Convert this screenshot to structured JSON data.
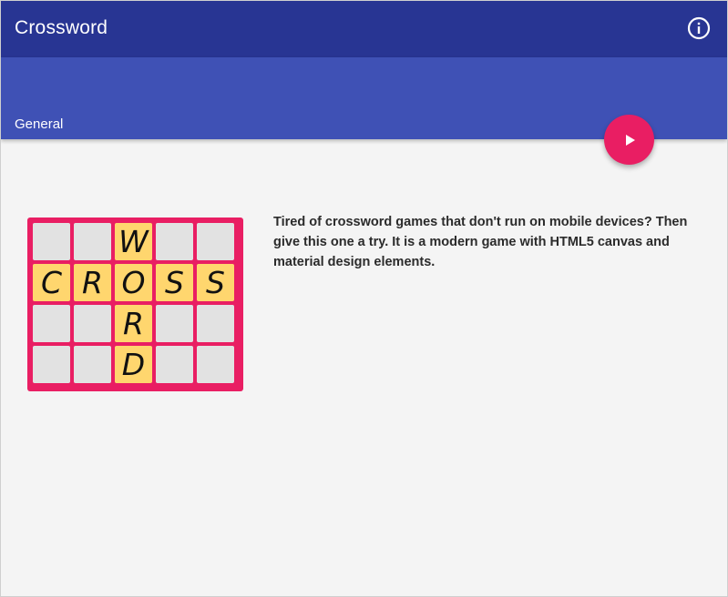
{
  "app": {
    "title": "Crossword"
  },
  "header": {
    "section_label": "General"
  },
  "icons": {
    "info": "info-icon",
    "play": "play-icon"
  },
  "colors": {
    "topbar": "#283593",
    "subbar": "#3f51b5",
    "accent": "#e91e63",
    "tile_filled": "#ffd66e",
    "tile_empty": "#e2e2e2"
  },
  "board": {
    "rows": [
      [
        "",
        "",
        "W",
        "",
        ""
      ],
      [
        "C",
        "R",
        "O",
        "S",
        "S"
      ],
      [
        "",
        "",
        "R",
        "",
        ""
      ],
      [
        "",
        "",
        "D",
        "",
        ""
      ]
    ]
  },
  "main": {
    "description": "Tired of crossword games that don't run on mobile devices? Then give this one a try. It is a modern game with HTML5 canvas and material design elements."
  }
}
